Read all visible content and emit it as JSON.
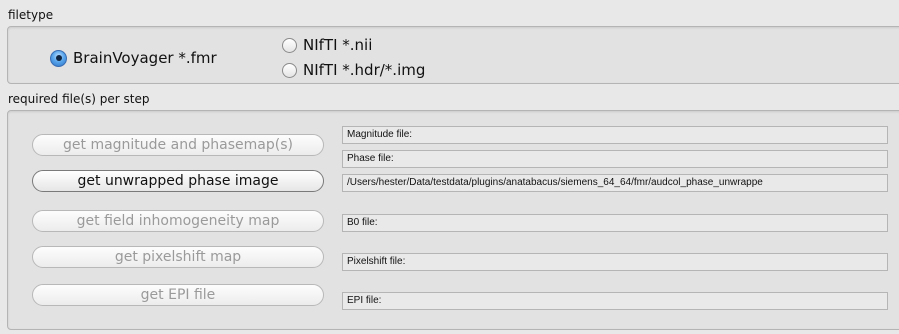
{
  "filetype": {
    "label": "filetype",
    "options": [
      {
        "label": "BrainVoyager *.fmr",
        "selected": true
      },
      {
        "label": "NIfTI *.nii",
        "selected": false
      },
      {
        "label": "NIfTI *.hdr/*.img",
        "selected": false
      }
    ]
  },
  "steps": {
    "label": "required file(s) per step",
    "buttons": [
      {
        "label": "get magnitude and phasemap(s)",
        "enabled": false
      },
      {
        "label": "get unwrapped phase image",
        "enabled": true
      },
      {
        "label": "get field inhomogeneity map",
        "enabled": false
      },
      {
        "label": "get pixelshift map",
        "enabled": false
      },
      {
        "label": "get EPI file",
        "enabled": false
      }
    ],
    "fields": [
      {
        "value": "Magnitude file:"
      },
      {
        "value": "Phase file:"
      },
      {
        "value": "/Users/hester/Data/testdata/plugins/anatabacus/siemens_64_64/fmr/audcol_phase_unwrappe"
      },
      {
        "value": "B0 file:"
      },
      {
        "value": "Pixelshift file:"
      },
      {
        "value": "EPI file:"
      }
    ]
  },
  "colors": {
    "background": "#e8e8e8",
    "radio_selected": "#2c73c6"
  }
}
